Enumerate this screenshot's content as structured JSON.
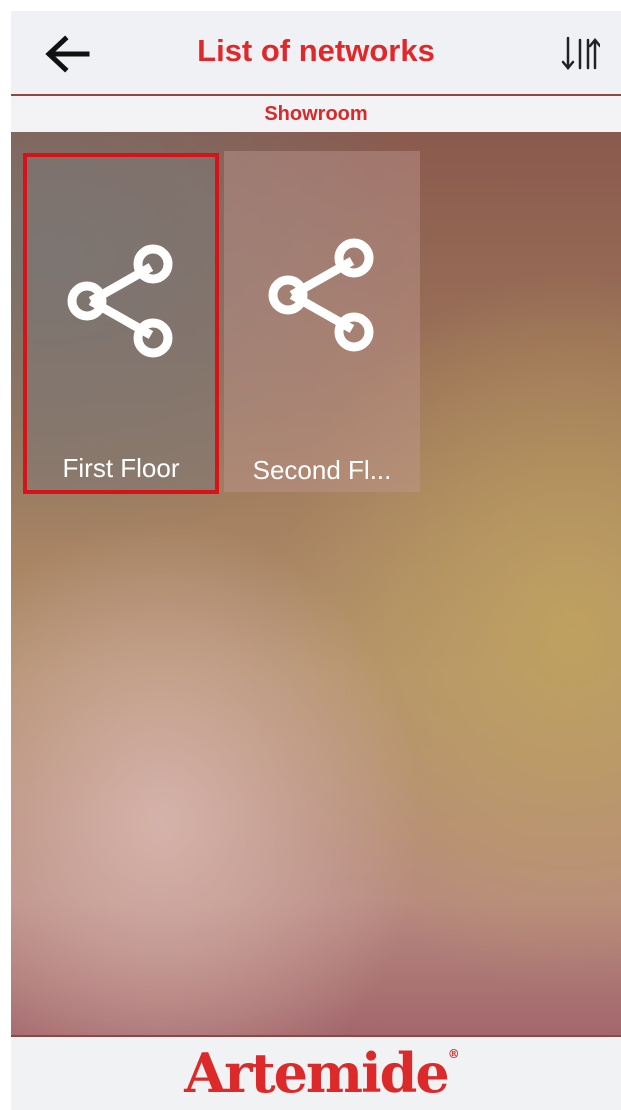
{
  "header": {
    "title": "List of networks",
    "back_icon": "arrow-left-icon",
    "sort_icon": "sort-arrows-icon"
  },
  "subheader": {
    "label": "Showroom"
  },
  "networks": [
    {
      "label": "First Floor",
      "icon": "share-icon",
      "selected": true
    },
    {
      "label": "Second Fl...",
      "icon": "share-icon",
      "selected": false
    }
  ],
  "footer": {
    "brand": "Artemide",
    "registered_mark": "®"
  },
  "colors": {
    "accent": "#e0282a",
    "selection_border": "#d41418",
    "header_background": "#eff1f4"
  }
}
